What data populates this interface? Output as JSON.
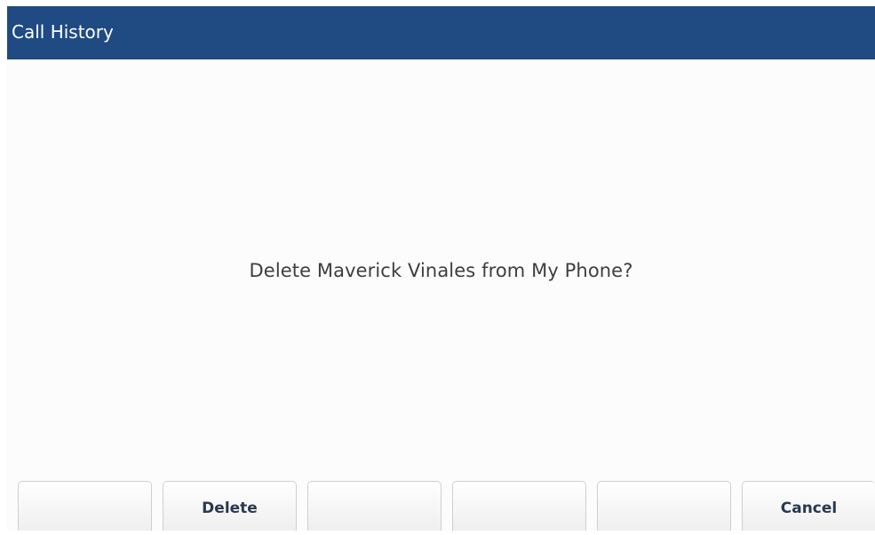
{
  "header": {
    "title": "Call History"
  },
  "dialog": {
    "message": "Delete Maverick Vinales from My Phone?"
  },
  "softkeys": [
    {
      "label": ""
    },
    {
      "label": "Delete"
    },
    {
      "label": ""
    },
    {
      "label": ""
    },
    {
      "label": ""
    },
    {
      "label": "Cancel"
    }
  ],
  "colors": {
    "title_bar": "#1f4a82",
    "background": "#fcfcfc",
    "prompt_text": "#3e3e3e",
    "softkey_text": "#2a3850"
  }
}
